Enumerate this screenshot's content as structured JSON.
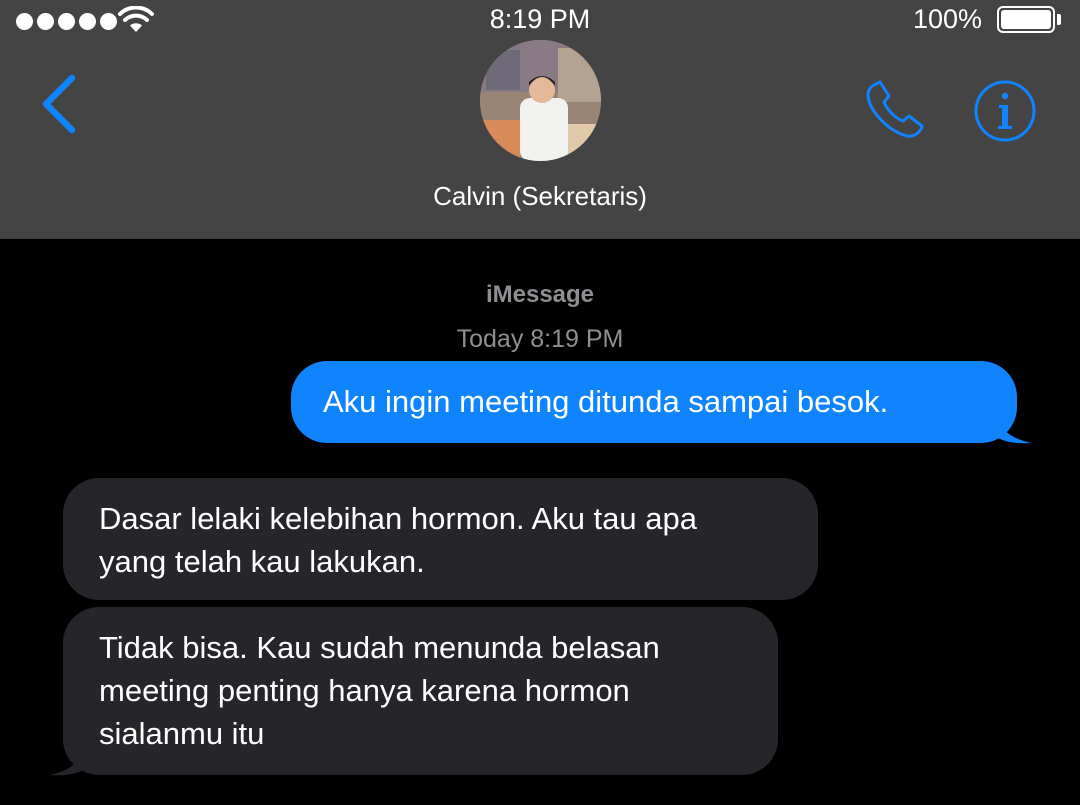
{
  "status_bar": {
    "time": "8:19 PM",
    "battery_percent": "100%",
    "signal_dots": 5,
    "battery_level": 1.0
  },
  "nav": {
    "contact_name": "Calvin (Sekretaris)",
    "back_icon": "chevron-left-icon",
    "call_icon": "phone-icon",
    "info_icon": "info-icon"
  },
  "thread": {
    "service": "iMessage",
    "timestamp": "Today 8:19 PM",
    "messages": [
      {
        "direction": "sent",
        "text": "Aku ingin meeting ditunda sampai besok."
      },
      {
        "direction": "received",
        "lines": [
          "Dasar lelaki kelebihan hormon. Aku tau apa",
          "yang telah kau lakukan."
        ]
      },
      {
        "direction": "received",
        "lines": [
          "Tidak bisa. Kau sudah menunda belasan",
          "meeting penting hanya karena hormon",
          "sialanmu itu"
        ]
      }
    ]
  },
  "colors": {
    "accent": "#1083fe",
    "header_bg": "#444444",
    "received_bubble": "#26252a",
    "muted_text": "#8e8e93"
  }
}
